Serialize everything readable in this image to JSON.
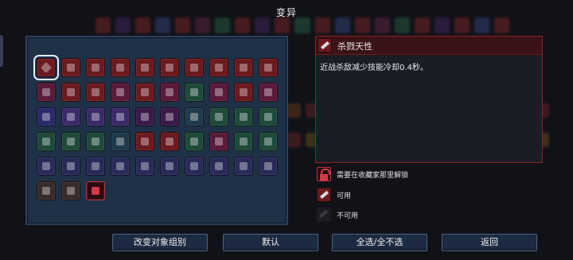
{
  "title": "变异",
  "selected_mutation": {
    "name": "杀戮天性",
    "description": "近战杀敌减少技能冷却0.4秒。",
    "icon": "sword-icon"
  },
  "mutations": [
    {
      "icon": "sword-icon",
      "color": "#6b1a1f",
      "selected": true
    },
    {
      "icon": "bow-icon",
      "color": "#6b1a1f"
    },
    {
      "icon": "blades-icon",
      "color": "#6b1a1f"
    },
    {
      "icon": "crossbow-icon",
      "color": "#6b1a1f"
    },
    {
      "icon": "no-entry-icon",
      "color": "#6b1a1f"
    },
    {
      "icon": "potion-icon",
      "color": "#6b1a1f"
    },
    {
      "icon": "hourglass-icon",
      "color": "#6b1a1f"
    },
    {
      "icon": "apple-icon",
      "color": "#6b1a1f"
    },
    {
      "icon": "star-icon",
      "color": "#6b1a1f"
    },
    {
      "icon": "lightning-icon",
      "color": "#6b1a1f"
    },
    {
      "icon": "skull-icon",
      "color": "#5a1a3a"
    },
    {
      "icon": "claw-icon",
      "color": "#6b1a1f"
    },
    {
      "icon": "ring-icon",
      "color": "#6b1a1f"
    },
    {
      "icon": "arrow-icon",
      "color": "#5a1a3a"
    },
    {
      "icon": "heart-icon",
      "color": "#6b1a1f"
    },
    {
      "icon": "magnet-icon",
      "color": "#5a1a3a"
    },
    {
      "icon": "tree-icon",
      "color": "#1f4a3a"
    },
    {
      "icon": "sword-slash-icon",
      "color": "#5a1a3a"
    },
    {
      "icon": "flask-icon",
      "color": "#6b1a1f"
    },
    {
      "icon": "hook-icon",
      "color": "#5a1a3a"
    },
    {
      "icon": "spear-icon",
      "color": "#2a2a6a"
    },
    {
      "icon": "dots-icon",
      "color": "#3a2a6a"
    },
    {
      "icon": "knife-icon",
      "color": "#3a2a6a"
    },
    {
      "icon": "book-icon",
      "color": "#3a2a6a"
    },
    {
      "icon": "feather-icon",
      "color": "#3a1a4a"
    },
    {
      "icon": "crossed-swords-icon",
      "color": "#3a1a4a"
    },
    {
      "icon": "orb-icon",
      "color": "#1f3a4a"
    },
    {
      "icon": "torch-icon",
      "color": "#1f4a3a"
    },
    {
      "icon": "eye-icon",
      "color": "#1f4a3a"
    },
    {
      "icon": "mask-icon",
      "color": "#1f4a3a"
    },
    {
      "icon": "cup-icon",
      "color": "#1f4a3a"
    },
    {
      "icon": "bolt-icon",
      "color": "#1f4a3a"
    },
    {
      "icon": "box-icon",
      "color": "#1f4a3a"
    },
    {
      "icon": "chest-icon",
      "color": "#1f3a4a"
    },
    {
      "icon": "fire-icon",
      "color": "#6b1a1f"
    },
    {
      "icon": "chevrons-icon",
      "color": "#6b1a1f"
    },
    {
      "icon": "shield-icon",
      "color": "#1f4a3a"
    },
    {
      "icon": "bomb-icon",
      "color": "#5a1a3a"
    },
    {
      "icon": "whirl-icon",
      "color": "#1f4a3a"
    },
    {
      "icon": "seed-icon",
      "color": "#1f4a3a"
    },
    {
      "icon": "double-arrow-icon",
      "color": "#2a2a5a"
    },
    {
      "icon": "plant-icon",
      "color": "#2a2a5a"
    },
    {
      "icon": "zombie-icon",
      "color": "#2a2a5a"
    },
    {
      "icon": "ghost-icon",
      "color": "#2a2a5a"
    },
    {
      "icon": "altar-icon",
      "color": "#2a2a5a"
    },
    {
      "icon": "gems-icon",
      "color": "#2a2a5a"
    },
    {
      "icon": "rocket-icon",
      "color": "#2a2a5a"
    },
    {
      "icon": "burst-icon",
      "color": "#2a2a5a"
    },
    {
      "icon": "fist-icon",
      "color": "#2a2a5a"
    },
    {
      "icon": "coins-icon",
      "color": "#2a2a5a"
    },
    {
      "icon": "flame-bottle-icon",
      "color": "#3a2a2a"
    },
    {
      "icon": "spark-icon",
      "color": "#3a2a2a"
    },
    {
      "icon": "lock-icon",
      "color": "#2a0c10",
      "locked": true
    }
  ],
  "legend": {
    "locked": "需要在收藏家那里解锁",
    "available": "可用",
    "unavailable": "不可用"
  },
  "buttons": {
    "change_group": "改变对象组别",
    "default": "默认",
    "select_all": "全选/全不选",
    "back": "返回"
  }
}
